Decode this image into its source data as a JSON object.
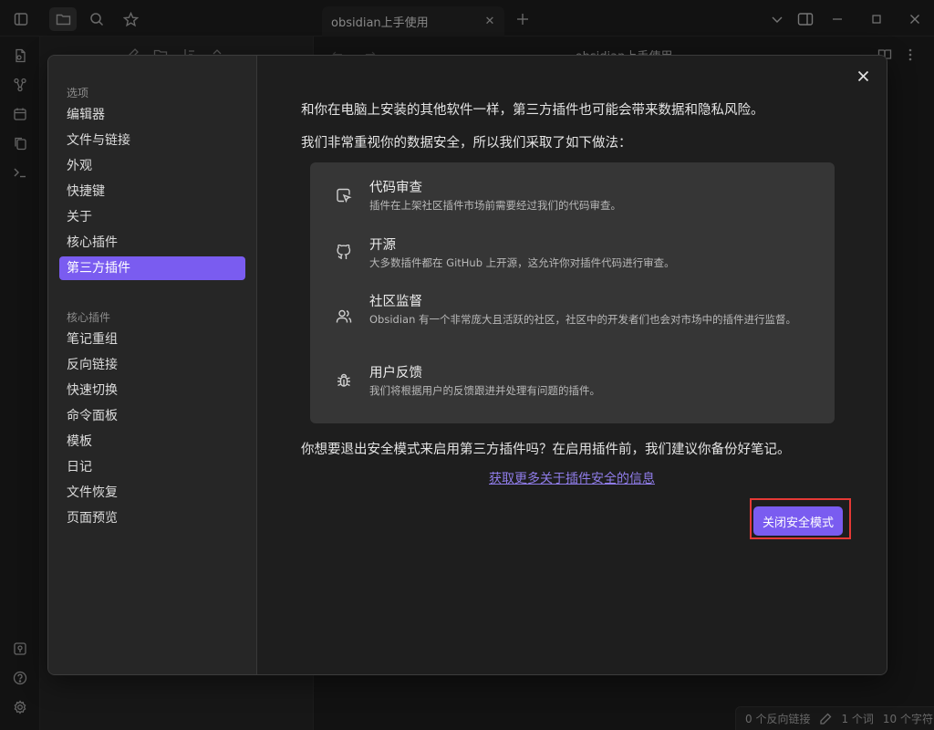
{
  "window": {
    "tab_title": "obsidian上手使用",
    "close_tab_glyph": "✕",
    "new_tab_glyph": "+"
  },
  "editor": {
    "title": "obsidian上手使用",
    "nav_arrows": "← →"
  },
  "statusbar": {
    "backlinks": "0 个反向链接",
    "words": "1 个词",
    "chars": "10 个字符"
  },
  "modal": {
    "close_glyph": "✕",
    "sidebar": {
      "options_heading": "选项",
      "options_items": [
        "编辑器",
        "文件与链接",
        "外观",
        "快捷键",
        "关于",
        "核心插件",
        "第三方插件"
      ],
      "active_index": 6,
      "core_heading": "核心插件",
      "core_items": [
        "笔记重组",
        "反向链接",
        "快速切换",
        "命令面板",
        "模板",
        "日记",
        "文件恢复",
        "页面预览"
      ]
    },
    "intro": "和你在电脑上安装的其他软件一样，第三方插件也可能会带来数据和隐私风险。",
    "measures_intro": "我们非常重视你的数据安全，所以我们采取了如下做法：",
    "features": [
      {
        "icon": "code-review-icon",
        "title": "代码审查",
        "desc": "插件在上架社区插件市场前需要经过我们的代码审查。"
      },
      {
        "icon": "github-icon",
        "title": "开源",
        "desc": "大多数插件都在 GitHub 上开源，这允许你对插件代码进行审查。"
      },
      {
        "icon": "users-icon",
        "title": "社区监督",
        "desc": "Obsidian 有一个非常庞大且活跃的社区，社区中的开发者们也会对市场中的插件进行监督。"
      },
      {
        "icon": "bug-icon",
        "title": "用户反馈",
        "desc": "我们将根据用户的反馈跟进并处理有问题的插件。"
      }
    ],
    "question": "你想要退出安全模式来启用第三方插件吗？在启用插件前，我们建议你备份好笔记。",
    "learn_more": "获取更多关于插件安全的信息",
    "disable_button": "关闭安全模式"
  },
  "colors": {
    "accent": "#7a5cf0",
    "highlight": "#e53935",
    "link": "#8f7ce8"
  }
}
